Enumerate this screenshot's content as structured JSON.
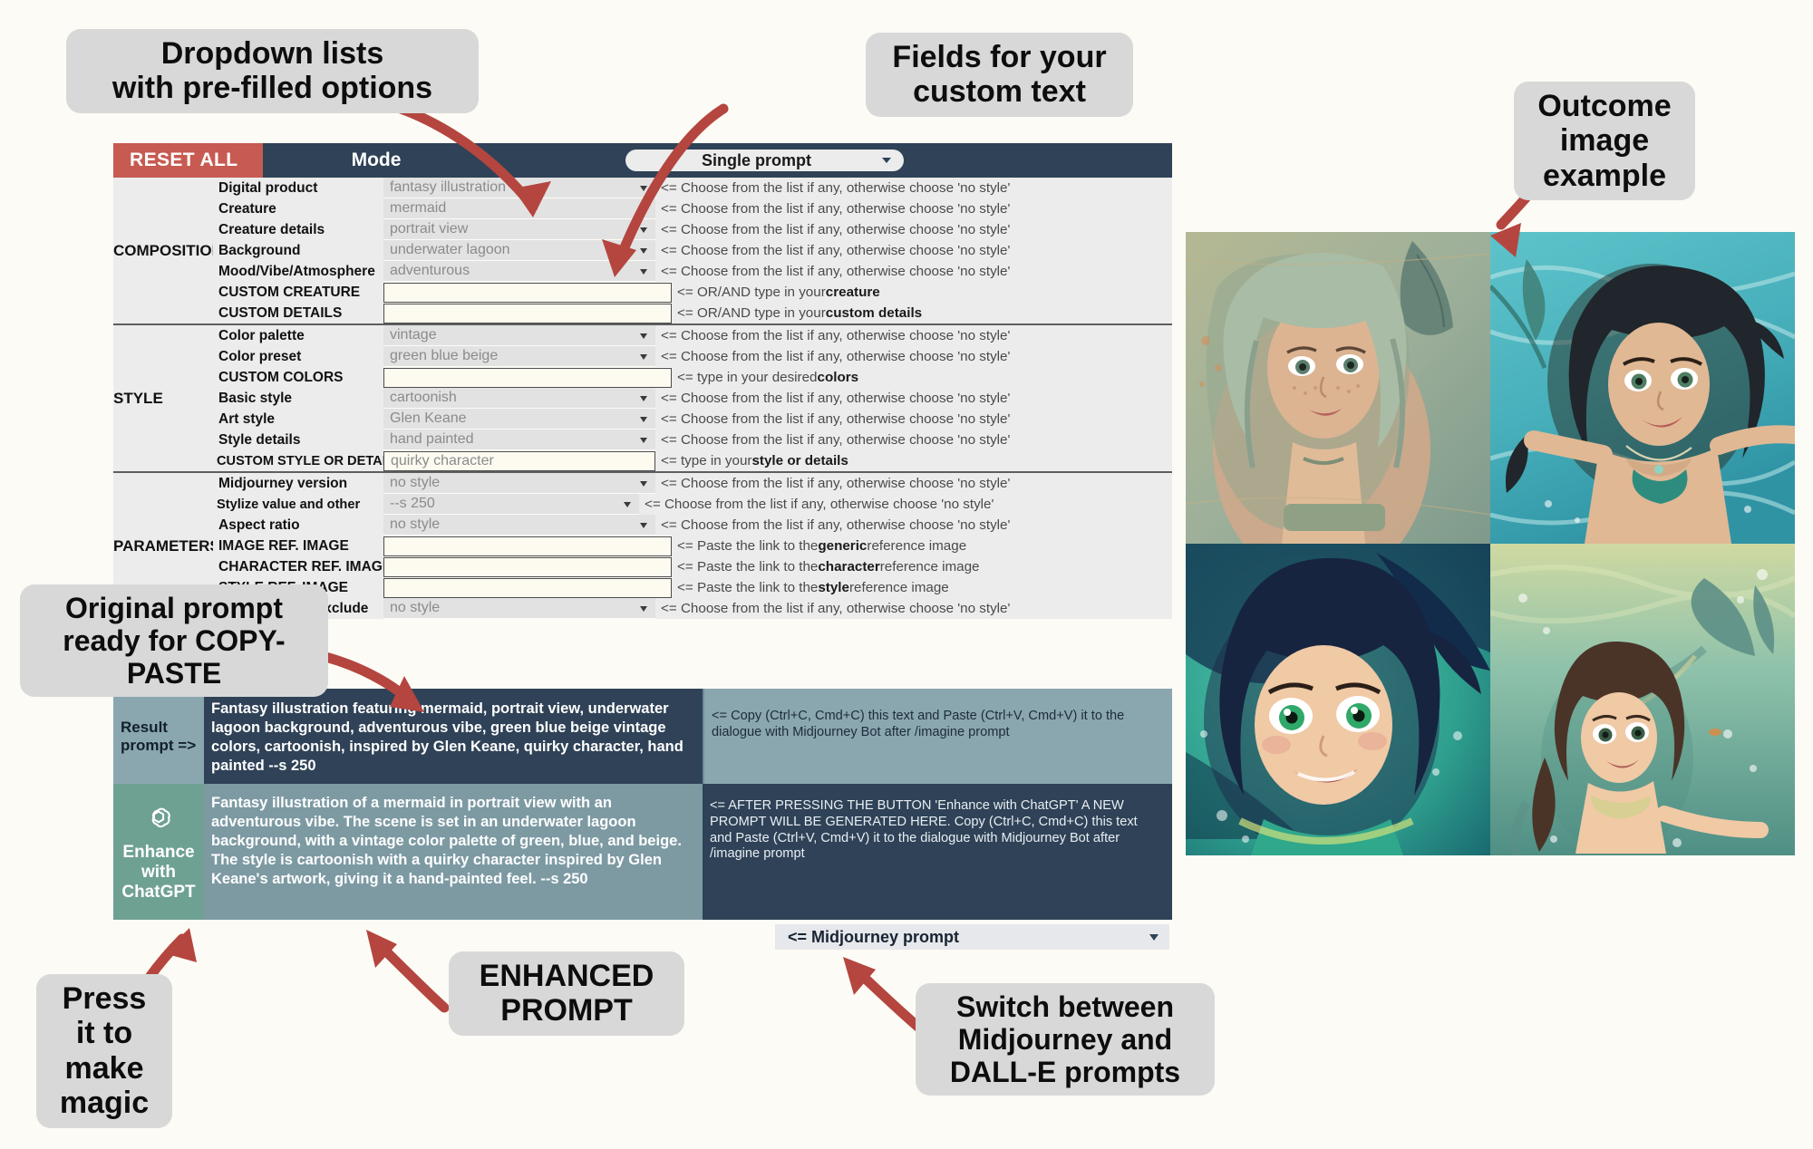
{
  "header": {
    "reset_all": "RESET ALL",
    "mode_label": "Mode",
    "mode_value": "Single prompt"
  },
  "hints": {
    "choose": "<= Choose from the list if any, otherwise choose 'no style'",
    "or_and": "<= OR/AND type in your ",
    "type_in": "<= type in your ",
    "paste": "<= Paste the link to the "
  },
  "sections": [
    {
      "name": "COMPOSITION",
      "rows": [
        {
          "label": "Digital product",
          "value": "fantasy illustration",
          "kind": "dropdown",
          "hint_pre": "<= Choose from the list if any, otherwise choose 'no style'",
          "hint_bold": "",
          "hint_post": ""
        },
        {
          "label": "Creature",
          "value": "mermaid",
          "kind": "dropdown",
          "hint_pre": "<= Choose from the list if any, otherwise choose 'no style'",
          "hint_bold": "",
          "hint_post": ""
        },
        {
          "label": "Creature details",
          "value": "portrait view",
          "kind": "dropdown",
          "hint_pre": "<= Choose from the list if any, otherwise choose 'no style'",
          "hint_bold": "",
          "hint_post": ""
        },
        {
          "label": "Background",
          "value": "underwater lagoon",
          "kind": "dropdown",
          "hint_pre": "<= Choose from the list if any, otherwise choose 'no style'",
          "hint_bold": "",
          "hint_post": ""
        },
        {
          "label": "Mood/Vibe/Atmosphere",
          "value": "adventurous",
          "kind": "dropdown",
          "hint_pre": "<= Choose from the list if any, otherwise choose 'no style'",
          "hint_bold": "",
          "hint_post": ""
        },
        {
          "label": "CUSTOM CREATURE",
          "value": "",
          "kind": "input",
          "hint_pre": "<= OR/AND type in your ",
          "hint_bold": "creature",
          "hint_post": ""
        },
        {
          "label": "CUSTOM DETAILS",
          "value": "",
          "kind": "input",
          "hint_pre": "<= OR/AND type in your ",
          "hint_bold": "custom details",
          "hint_post": ""
        }
      ]
    },
    {
      "name": "STYLE",
      "rows": [
        {
          "label": "Color palette",
          "value": "vintage",
          "kind": "dropdown",
          "hint_pre": "<= Choose from the list if any, otherwise choose 'no style'",
          "hint_bold": "",
          "hint_post": ""
        },
        {
          "label": "Color preset",
          "value": "green blue beige",
          "kind": "dropdown",
          "hint_pre": "<= Choose from the list if any, otherwise choose 'no style'",
          "hint_bold": "",
          "hint_post": ""
        },
        {
          "label": "CUSTOM COLORS",
          "value": "",
          "kind": "input",
          "hint_pre": "<= type in your desired ",
          "hint_bold": "colors",
          "hint_post": ""
        },
        {
          "label": "Basic style",
          "value": "cartoonish",
          "kind": "dropdown",
          "hint_pre": "<= Choose from the list if any, otherwise choose 'no style'",
          "hint_bold": "",
          "hint_post": ""
        },
        {
          "label": "Art style",
          "value": "Glen Keane",
          "kind": "dropdown",
          "hint_pre": "<= Choose from the list if any, otherwise choose 'no style'",
          "hint_bold": "",
          "hint_post": ""
        },
        {
          "label": "Style details",
          "value": "hand painted",
          "kind": "dropdown",
          "hint_pre": "<= Choose from the list if any, otherwise choose 'no style'",
          "hint_bold": "",
          "hint_post": ""
        },
        {
          "label": "CUSTOM STYLE OR DETAILS",
          "value": "quirky character",
          "kind": "input",
          "hint_pre": "<= type in your ",
          "hint_bold": "style or details",
          "hint_post": ""
        }
      ]
    },
    {
      "name": "PARAMETERS",
      "rows": [
        {
          "label": "Midjourney version",
          "value": "no style",
          "kind": "dropdown",
          "hint_pre": "<= Choose from the list if any, otherwise choose 'no style'",
          "hint_bold": "",
          "hint_post": ""
        },
        {
          "label": "Stylize value and other",
          "value": "--s 250",
          "kind": "dropdown",
          "hint_pre": "<= Choose from the list if any, otherwise choose 'no style'",
          "hint_bold": "",
          "hint_post": ""
        },
        {
          "label": "Aspect ratio",
          "value": "no style",
          "kind": "dropdown",
          "hint_pre": "<= Choose from the list if any, otherwise choose 'no style'",
          "hint_bold": "",
          "hint_post": ""
        },
        {
          "label": "IMAGE REF. IMAGE",
          "value": "",
          "kind": "input",
          "hint_pre": "<= Paste the link to the ",
          "hint_bold": "generic",
          "hint_post": " reference image"
        },
        {
          "label": "CHARACTER REF. IMAGE",
          "value": "",
          "kind": "input",
          "hint_pre": "<= Paste the link to the ",
          "hint_bold": "character",
          "hint_post": " reference image"
        },
        {
          "label": "STYLE REF. IMAGE",
          "value": "",
          "kind": "input",
          "hint_pre": "<= Paste the link to the ",
          "hint_bold": "style",
          "hint_post": " reference image"
        },
        {
          "label": "Parameters to exclude",
          "value": "no style",
          "kind": "dropdown",
          "hint_pre": "<= Choose from the list if any, otherwise choose 'no style'",
          "hint_bold": "",
          "hint_post": ""
        }
      ]
    }
  ],
  "result": {
    "label": "Result\nprompt =>",
    "text": "Fantasy illustration featuring mermaid, portrait view, underwater lagoon background, adventurous vibe, green blue beige vintage colors, cartoonish, inspired by Glen Keane, quirky character, hand painted --s 250",
    "hint": "<= Copy (Ctrl+C, Cmd+C) this text and Paste (Ctrl+V, Cmd+V) it to the dialogue with Midjourney Bot after /imagine prompt"
  },
  "enhanced": {
    "button_line1": "Enhance",
    "button_line2": "with",
    "button_line3": "ChatGPT",
    "text": "Fantasy illustration of a mermaid in portrait view with an adventurous vibe. The scene is set in an underwater lagoon background, with a vintage color palette of green, blue, and beige. The style is cartoonish with a quirky character inspired by Glen Keane's artwork, giving it a hand-painted feel.  --s 250",
    "hint": "<= AFTER PRESSING THE BUTTON 'Enhance with ChatGPT' A NEW PROMPT WILL BE GENERATED HERE. Copy (Ctrl+C, Cmd+C) this text and Paste (Ctrl+V, Cmd+V) it to the dialogue with Midjourney Bot after /imagine prompt"
  },
  "prompt_type_select": {
    "value": "<= Midjourney prompt"
  },
  "callouts": {
    "dropdowns": "Dropdown lists\nwith pre-filled options",
    "custom_fields": "Fields for your\ncustom text",
    "outcome": "Outcome\nimage\nexample",
    "original_prompt": "Original prompt\nready for COPY-\nPASTE",
    "press_it": "Press\nit to\nmake\nmagic",
    "enhanced_prompt": "ENHANCED\nPROMPT",
    "switch": "Switch between\nMidjourney and\nDALL-E prompts"
  },
  "colors": {
    "reset_red": "#c75a51",
    "header_navy": "#2f4257",
    "result_blue": "#8aa7b0",
    "gpt_green": "#6fa193",
    "arrow_red": "#b4463f",
    "callout_gray": "#d8d8d8"
  }
}
